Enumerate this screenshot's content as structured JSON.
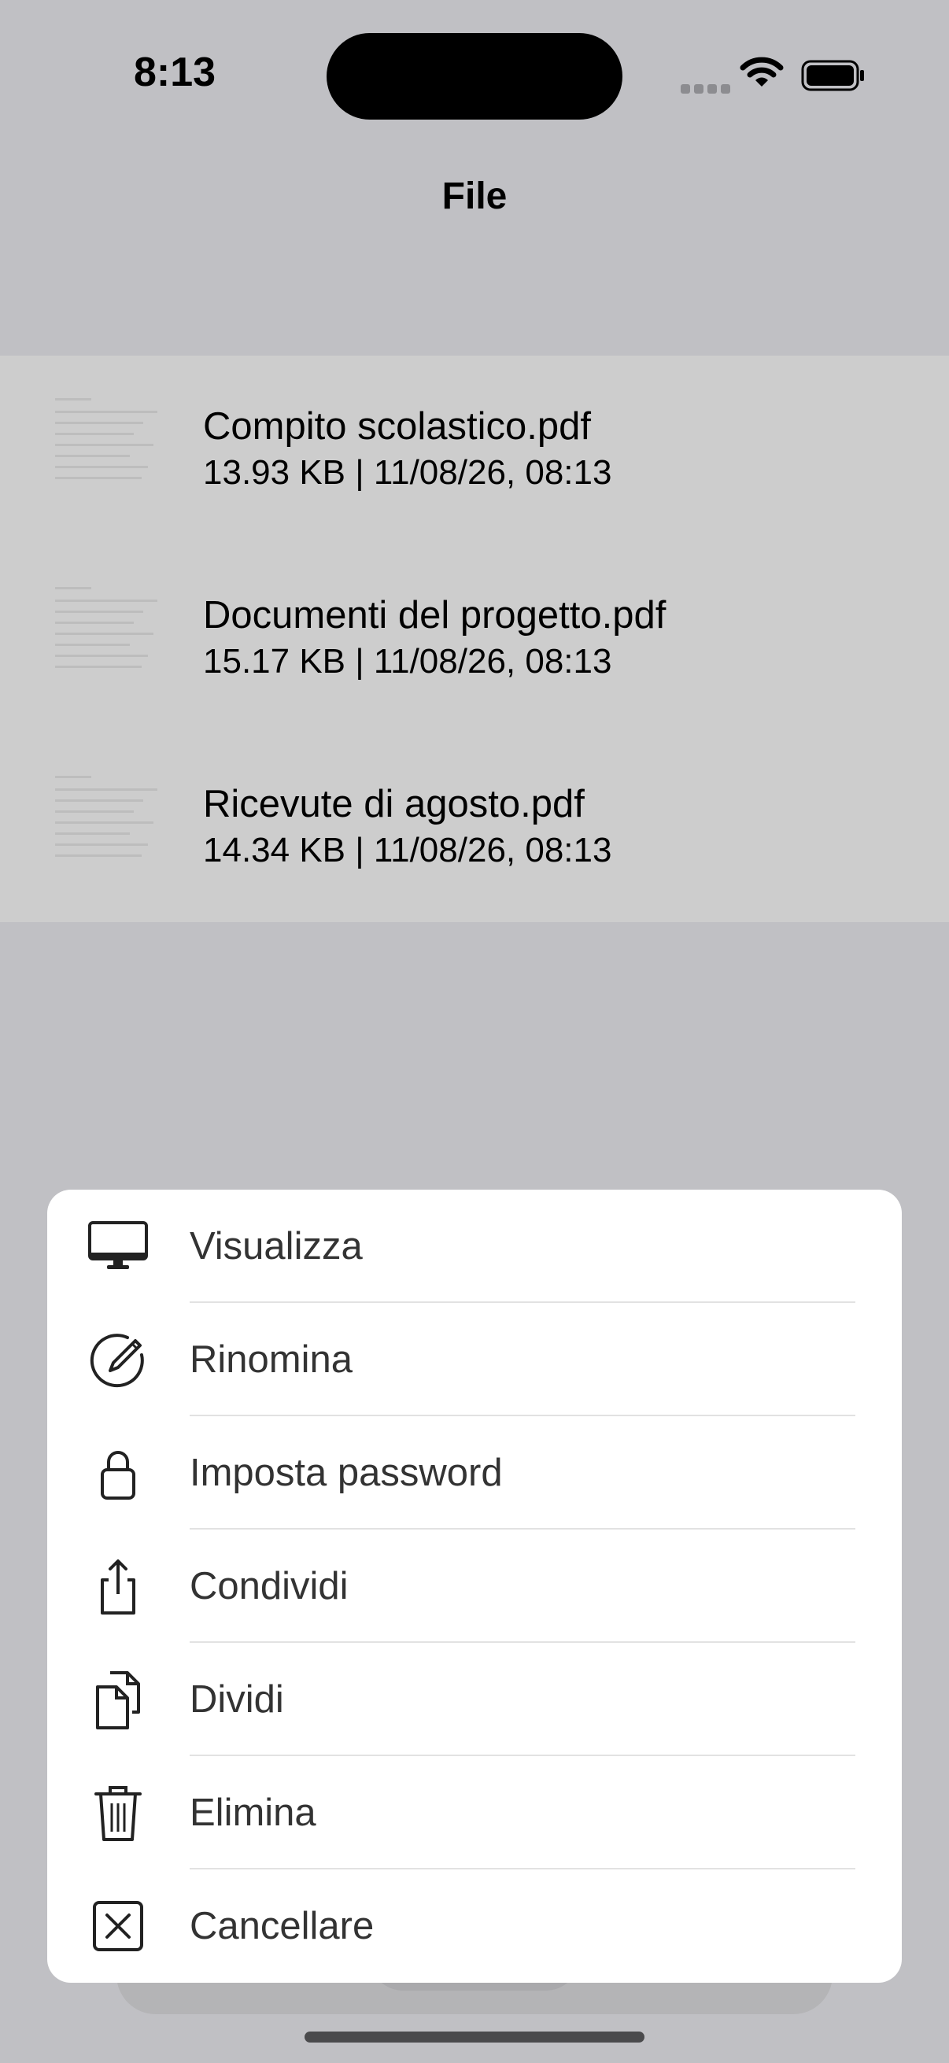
{
  "status_bar": {
    "time": "8:13"
  },
  "header": {
    "title": "File"
  },
  "files": [
    {
      "name": "Compito scolastico.pdf",
      "meta": "13.93 KB | 11/08/26, 08:13"
    },
    {
      "name": "Documenti del progetto.pdf",
      "meta": "15.17 KB | 11/08/26, 08:13"
    },
    {
      "name": "Ricevute di agosto.pdf",
      "meta": "14.34 KB | 11/08/26, 08:13"
    }
  ],
  "actions": [
    {
      "label": "Visualizza",
      "icon": "monitor-icon"
    },
    {
      "label": "Rinomina",
      "icon": "pencil-circle-icon"
    },
    {
      "label": "Imposta password",
      "icon": "lock-icon"
    },
    {
      "label": "Condividi",
      "icon": "share-icon"
    },
    {
      "label": "Dividi",
      "icon": "split-documents-icon"
    },
    {
      "label": "Elimina",
      "icon": "trash-icon"
    },
    {
      "label": "Cancellare",
      "icon": "xmark-square-icon"
    }
  ],
  "colors": {
    "background": "#c0c0c4",
    "list_background": "#cdcdcd",
    "sheet_background": "#ffffff"
  }
}
